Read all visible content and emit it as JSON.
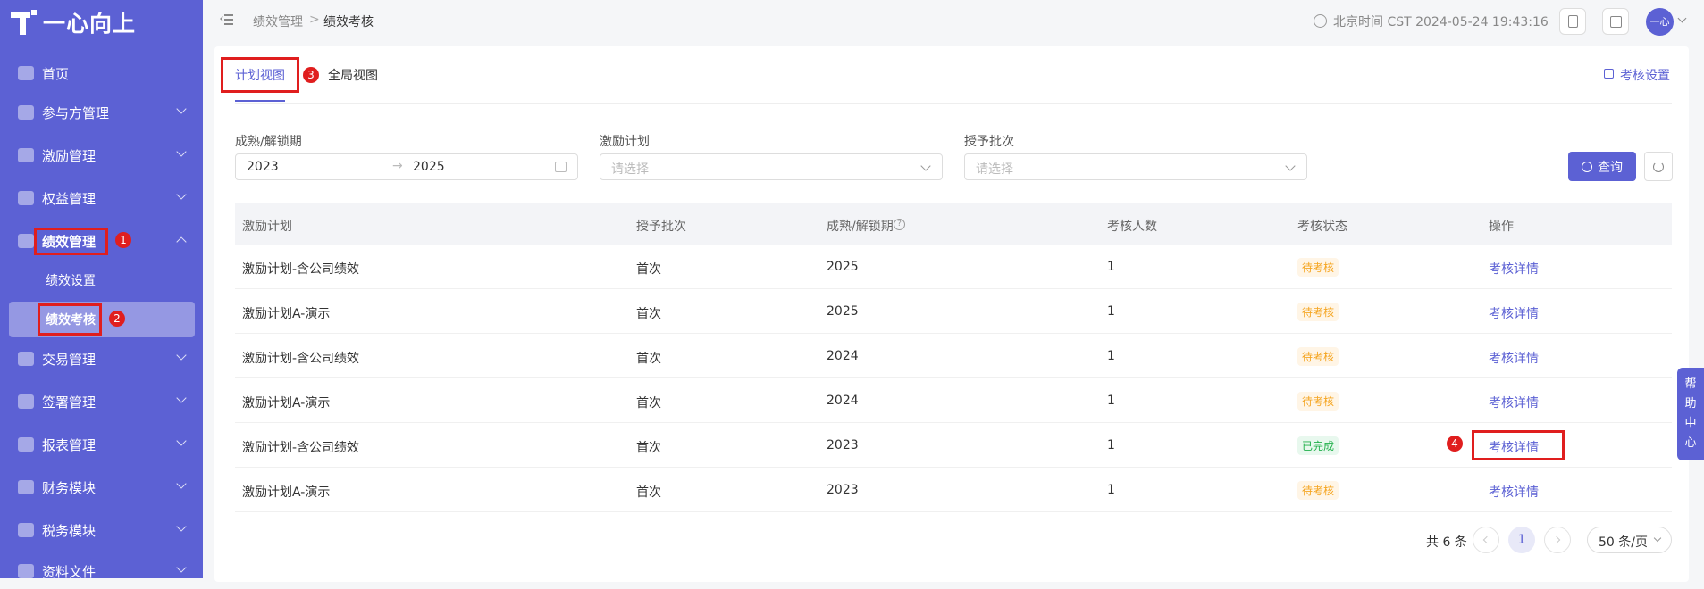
{
  "app": {
    "logo_text": "一心向上"
  },
  "sidebar": {
    "items": [
      {
        "label": "首页",
        "icon": "home-icon"
      },
      {
        "label": "参与方管理",
        "icon": "group-icon"
      },
      {
        "label": "激励管理",
        "icon": "incentive-icon"
      },
      {
        "label": "权益管理",
        "icon": "equity-icon"
      },
      {
        "label": "绩效管理",
        "icon": "crown-icon"
      },
      {
        "label": "交易管理",
        "icon": "trade-icon"
      },
      {
        "label": "签署管理",
        "icon": "sign-icon"
      },
      {
        "label": "报表管理",
        "icon": "report-icon"
      },
      {
        "label": "财务模块",
        "icon": "finance-icon"
      },
      {
        "label": "税务模块",
        "icon": "tax-icon"
      },
      {
        "label": "资料文件",
        "icon": "file-icon"
      }
    ],
    "sub_items": [
      {
        "label": "绩效设置"
      },
      {
        "label": "绩效考核"
      }
    ]
  },
  "breadcrumb": {
    "parent": "绩效管理",
    "separator": ">",
    "current": "绩效考核"
  },
  "topbar": {
    "time": "北京时间 CST 2024-05-24 19:43:16",
    "avatar": "一心"
  },
  "tabs": [
    {
      "label": "计划视图"
    },
    {
      "label": "全局视图"
    }
  ],
  "settings_link": "考核设置",
  "filters": {
    "period": {
      "label": "成熟/解锁期",
      "start": "2023",
      "end": "2025",
      "arrow": "→"
    },
    "plan": {
      "label": "激励计划",
      "placeholder": "请选择"
    },
    "batch": {
      "label": "授予批次",
      "placeholder": "请选择"
    }
  },
  "search_button": "查询",
  "table": {
    "headers": [
      "激励计划",
      "授予批次",
      "成熟/解锁期",
      "考核人数",
      "考核状态",
      "操作"
    ],
    "rows": [
      {
        "plan": "激励计划-含公司绩效",
        "batch": "首次",
        "period": "2025",
        "count": "1",
        "status": "待考核",
        "action": "考核详情"
      },
      {
        "plan": "激励计划A-演示",
        "batch": "首次",
        "period": "2025",
        "count": "1",
        "status": "待考核",
        "action": "考核详情"
      },
      {
        "plan": "激励计划-含公司绩效",
        "batch": "首次",
        "period": "2024",
        "count": "1",
        "status": "待考核",
        "action": "考核详情"
      },
      {
        "plan": "激励计划A-演示",
        "batch": "首次",
        "period": "2024",
        "count": "1",
        "status": "待考核",
        "action": "考核详情"
      },
      {
        "plan": "激励计划-含公司绩效",
        "batch": "首次",
        "period": "2023",
        "count": "1",
        "status": "已完成",
        "action": "考核详情"
      },
      {
        "plan": "激励计划A-演示",
        "batch": "首次",
        "period": "2023",
        "count": "1",
        "status": "待考核",
        "action": "考核详情"
      }
    ]
  },
  "pagination": {
    "total": "共 6 条",
    "page": "1",
    "page_size": "50 条/页"
  },
  "help": [
    "帮",
    "助",
    "中",
    "心"
  ],
  "annotations": [
    "1",
    "2",
    "3",
    "4"
  ],
  "colors": {
    "accent": "#5c61d4",
    "annotation": "#e01e1e",
    "pending": "#f5a623",
    "done": "#22b04b"
  }
}
